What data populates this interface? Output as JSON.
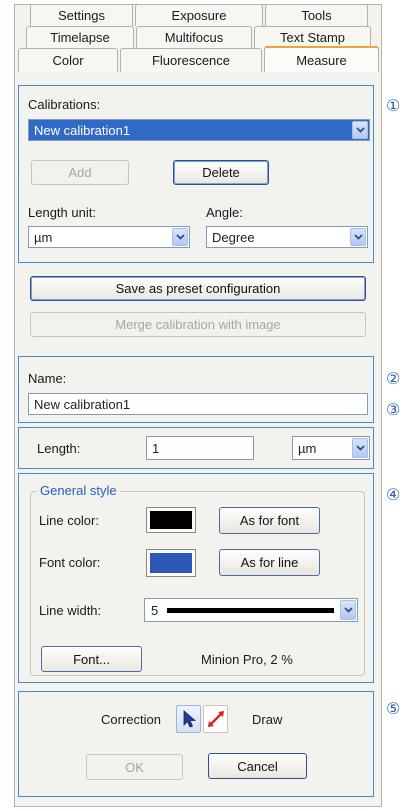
{
  "tabs": {
    "row1": [
      "Settings",
      "Exposure",
      "Tools"
    ],
    "row2": [
      "Timelapse",
      "Multifocus",
      "Text Stamp"
    ],
    "row3": [
      "Color",
      "Fluorescence",
      "Measure"
    ],
    "active": "Measure"
  },
  "markers": [
    "①",
    "②",
    "③",
    "④",
    "⑤"
  ],
  "calibrations": {
    "label": "Calibrations:",
    "selected": "New calibration1",
    "add_label": "Add",
    "delete_label": "Delete",
    "length_unit_label": "Length unit:",
    "length_unit_value": "µm",
    "angle_label": "Angle:",
    "angle_value": "Degree",
    "save_preset_label": "Save as preset configuration",
    "merge_label": "Merge calibration with image"
  },
  "name_section": {
    "label": "Name:",
    "value": "New calibration1"
  },
  "length_section": {
    "label": "Length:",
    "value": "1",
    "unit": "µm"
  },
  "style": {
    "group_title": "General style",
    "line_color_label": "Line color:",
    "line_color": "#000000",
    "as_for_font_label": "As for font",
    "font_color_label": "Font color:",
    "font_color": "#2d56b5",
    "as_for_line_label": "As for line",
    "line_width_label": "Line width:",
    "line_width_value": "5",
    "font_button_label": "Font...",
    "font_info": "Minion Pro, 2 %"
  },
  "footer": {
    "correction_label": "Correction",
    "draw_label": "Draw",
    "ok_label": "OK",
    "cancel_label": "Cancel"
  }
}
